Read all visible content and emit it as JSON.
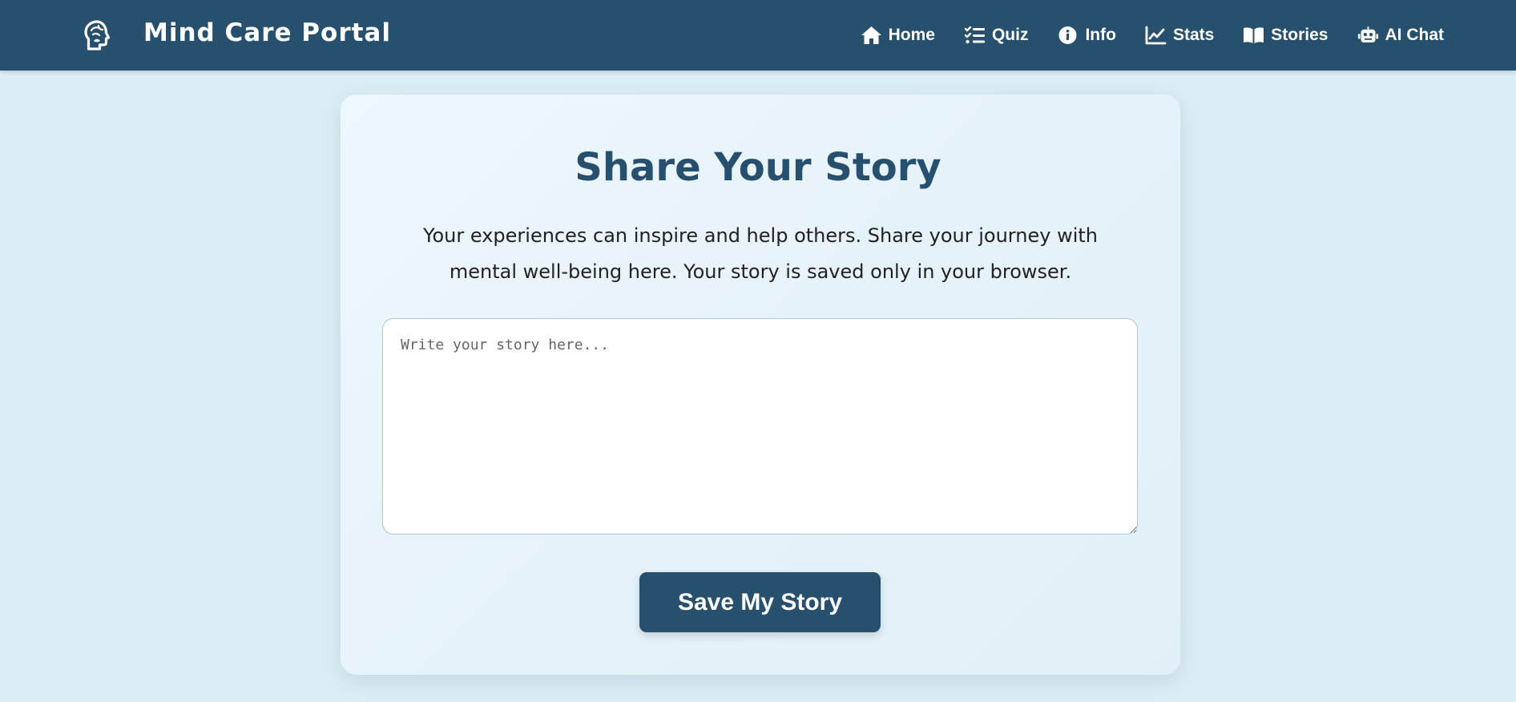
{
  "navbar": {
    "brand_title": "Mind Care Portal",
    "brand_icon": "brain-head-icon",
    "links": [
      {
        "label": "Home",
        "icon": "home-icon"
      },
      {
        "label": "Quiz",
        "icon": "checklist-icon"
      },
      {
        "label": "Info",
        "icon": "info-icon"
      },
      {
        "label": "Stats",
        "icon": "line-chart-icon"
      },
      {
        "label": "Stories",
        "icon": "book-icon"
      },
      {
        "label": "AI Chat",
        "icon": "robot-icon"
      }
    ]
  },
  "main": {
    "title": "Share Your Story",
    "description": "Your experiences can inspire and help others. Share your journey with mental well-being here. Your story is saved only in your browser.",
    "story_input": {
      "placeholder": "Write your story here...",
      "value": ""
    },
    "save_button_label": "Save My Story"
  },
  "colors": {
    "primary": "#27506f",
    "background": "#dcedf5",
    "card": "#eaf5fb"
  }
}
